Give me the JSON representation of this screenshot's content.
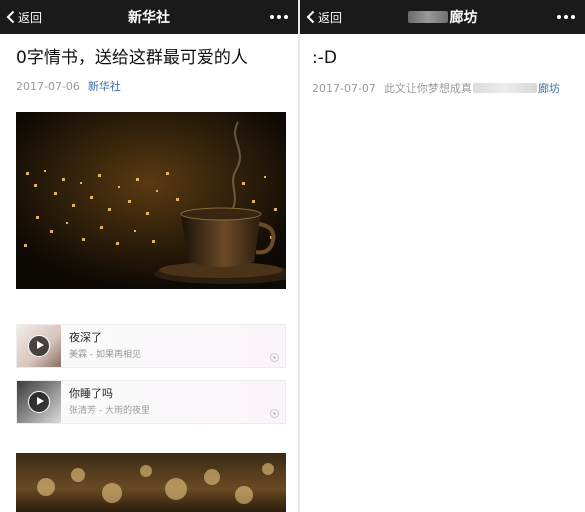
{
  "left": {
    "nav": {
      "back_label": "返回",
      "title": "新华社"
    },
    "article": {
      "title": "0字情书，送给这群最可爱的人",
      "date": "2017-07-06",
      "account": "新华社"
    },
    "music_cards": [
      {
        "title": "夜深了",
        "artist": "美霖 - 如果再相见"
      },
      {
        "title": "你睡了吗",
        "artist": "张清芳 - 大雨的夜里"
      }
    ]
  },
  "right": {
    "nav": {
      "back_label": "返回",
      "title_suffix": "廊坊"
    },
    "article": {
      "title": ":-D",
      "date": "2017-07-07",
      "meta_text": "此文让你梦想成真",
      "account_suffix": "廊坊"
    }
  },
  "colors": {
    "navbar_bg": "#1a1a1a",
    "link": "#3b6ea8",
    "meta_gray": "#9a9a9a"
  }
}
